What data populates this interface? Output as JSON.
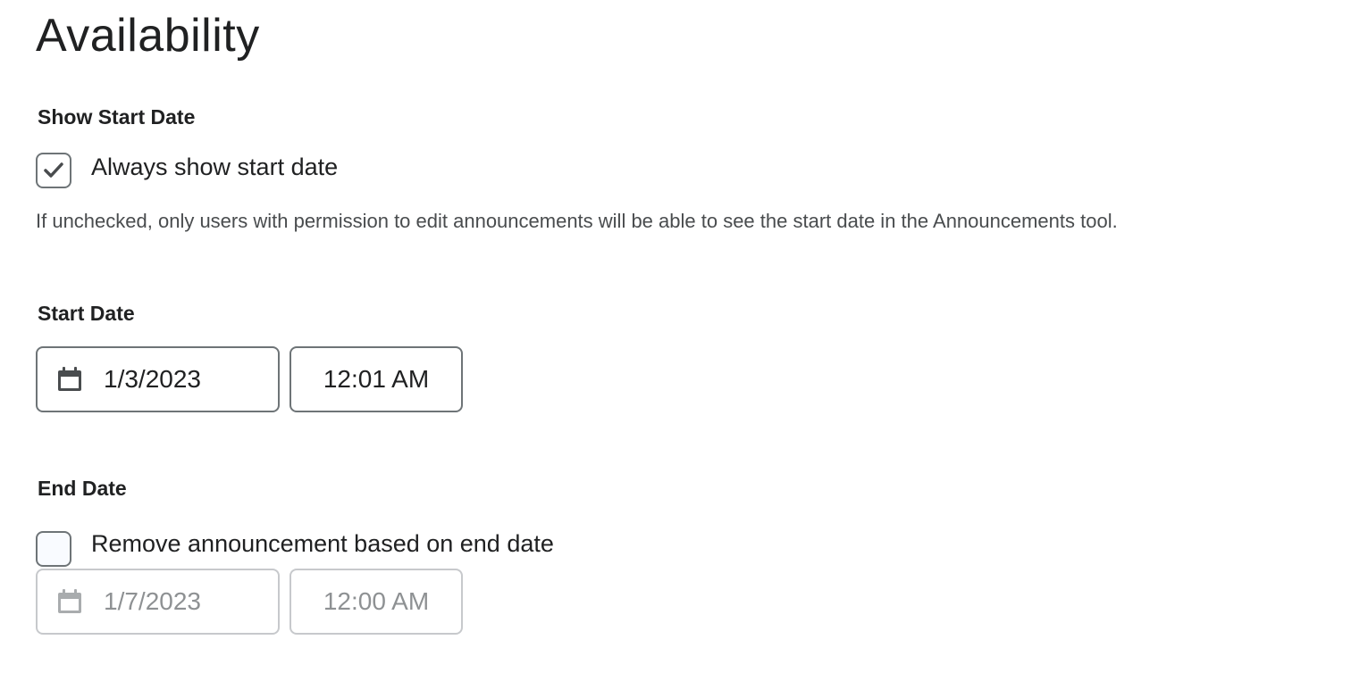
{
  "page": {
    "title": "Availability"
  },
  "show_start_date": {
    "label": "Show Start Date",
    "checkbox_label": "Always show start date",
    "checked": true,
    "help_text": "If unchecked, only users with permission to edit announcements will be able to see the start date in the Announcements tool."
  },
  "start_date": {
    "label": "Start Date",
    "date_value": "1/3/2023",
    "time_value": "12:01 AM",
    "icon": "calendar-icon"
  },
  "end_date": {
    "label": "End Date",
    "checkbox_label": "Remove announcement based on end date",
    "checked": false,
    "date_value": "1/7/2023",
    "time_value": "12:00 AM",
    "icon": "calendar-icon",
    "disabled": true
  },
  "colors": {
    "text": "#202122",
    "help_text": "#494c4e",
    "border": "#6e7477",
    "border_disabled": "#c7c9cc",
    "text_disabled": "#8e9193"
  }
}
